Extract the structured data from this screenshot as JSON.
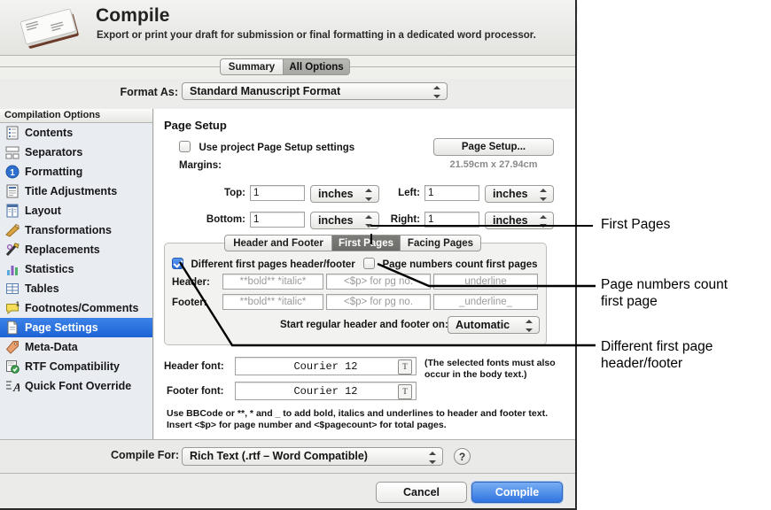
{
  "window": {
    "title": "Compile",
    "subtitle": "Export or print your draft for submission or final formatting in a dedicated word processor.",
    "icon": "manuscript-stack-icon"
  },
  "top_tabs": {
    "summary": "Summary",
    "all_options": "All Options",
    "selected": "All Options"
  },
  "format_as": {
    "label": "Format As:",
    "value": "Standard Manuscript Format"
  },
  "sidebar": {
    "header": "Compilation Options",
    "selected": "Page Settings",
    "items": [
      {
        "label": "Contents",
        "icon": "list-document-icon"
      },
      {
        "label": "Separators",
        "icon": "separators-icon"
      },
      {
        "label": "Formatting",
        "icon": "numbered-circle-icon"
      },
      {
        "label": "Title Adjustments",
        "icon": "title-document-icon"
      },
      {
        "label": "Layout",
        "icon": "layout-columns-icon"
      },
      {
        "label": "Transformations",
        "icon": "eraser-icon"
      },
      {
        "label": "Replacements",
        "icon": "pencil-wand-icon"
      },
      {
        "label": "Statistics",
        "icon": "bar-chart-icon"
      },
      {
        "label": "Tables",
        "icon": "table-grid-icon"
      },
      {
        "label": "Footnotes/Comments",
        "icon": "comment-bubble-icon"
      },
      {
        "label": "Page Settings",
        "icon": "page-icon"
      },
      {
        "label": "Meta-Data",
        "icon": "tag-icon"
      },
      {
        "label": "RTF Compatibility",
        "icon": "rtf-check-icon"
      },
      {
        "label": "Quick Font Override",
        "icon": "font-a-icon"
      }
    ]
  },
  "page_setup": {
    "section_title": "Page Setup",
    "use_project_label": "Use project Page Setup settings",
    "use_project_checked": false,
    "page_setup_button": "Page Setup...",
    "paper_size": "21.59cm x 27.94cm",
    "margins_label": "Margins:",
    "margins": [
      {
        "label": "Top:",
        "value": "1",
        "unit": "inches"
      },
      {
        "label": "Left:",
        "value": "1",
        "unit": "inches"
      },
      {
        "label": "Bottom:",
        "value": "1",
        "unit": "inches"
      },
      {
        "label": "Right:",
        "value": "1",
        "unit": "inches"
      }
    ]
  },
  "hf_panel": {
    "tabs": [
      "Header and Footer",
      "First Pages",
      "Facing Pages"
    ],
    "selected_tab": "First Pages",
    "different_first_label": "Different first pages header/footer",
    "different_first_checked": true,
    "page_numbers_label": "Page numbers count first pages",
    "page_numbers_checked": false,
    "rows": [
      {
        "label": "Header:",
        "left_placeholder": "**bold** *italic*",
        "center_placeholder": "<$p> for pg no.",
        "right_placeholder": "_underline_"
      },
      {
        "label": "Footer:",
        "left_placeholder": "**bold** *italic*",
        "center_placeholder": "<$p> for pg no.",
        "right_placeholder": "_underline_"
      }
    ],
    "start_regular_label": "Start regular header and footer on:",
    "start_regular_value": "Automatic"
  },
  "fonts": {
    "header_font_label": "Header font:",
    "header_font_value": "Courier 12",
    "footer_font_label": "Footer font:",
    "footer_font_value": "Courier 12",
    "note": "(The selected fonts\nmust also occur in the\nbody text.)",
    "help_text": "Use BBCode or **, * and _ to add bold, italics and underlines to header and\nfooter text. Insert <$p> for page number and <$pagecount> for total pages."
  },
  "footer_bar": {
    "compile_for_label": "Compile For:",
    "compile_for_value": "Rich Text (.rtf – Word Compatible)",
    "help_glyph": "?",
    "cancel": "Cancel",
    "compile": "Compile"
  },
  "callouts": [
    {
      "text": "First Pages"
    },
    {
      "text": "Page numbers count\nfirst page"
    },
    {
      "text": "Different first page\nheader/footer"
    }
  ],
  "colors": {
    "selection_blue": "#2d6fd8",
    "default_button_blue": "#2f74e0",
    "dialog_bg": "#ececec",
    "sidebar_bg": "#e9ecf1"
  }
}
